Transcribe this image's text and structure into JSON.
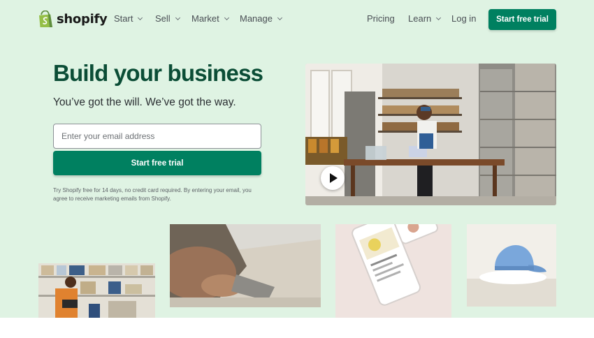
{
  "header": {
    "logo_text": "shopify",
    "nav_left": [
      {
        "label": "Start"
      },
      {
        "label": "Sell"
      },
      {
        "label": "Market"
      },
      {
        "label": "Manage"
      }
    ],
    "nav_right": {
      "pricing": "Pricing",
      "learn": "Learn",
      "login": "Log in",
      "cta": "Start free trial"
    }
  },
  "hero": {
    "headline": "Build your business",
    "subheadline": "You’ve got the will. We’ve got the way.",
    "email_placeholder": "Enter your email address",
    "email_value": "",
    "cta": "Start free trial",
    "disclaimer": "Try Shopify free for 14 days, no credit card required. By entering your email, you agree to receive marketing emails from Shopify."
  },
  "media": {
    "video_play_icon": "play-icon",
    "photos": [
      "video-thumbnail-shop-owner",
      "warehouse-tablet-photo",
      "woodworking-hands-photo",
      "phone-store-app-photo",
      "blue-cap-product-photo"
    ]
  },
  "colors": {
    "hero_background": "#dff3e3",
    "brand_green": "#008060",
    "headline_green": "#0b4d36",
    "logo_green": "#95bf47"
  }
}
